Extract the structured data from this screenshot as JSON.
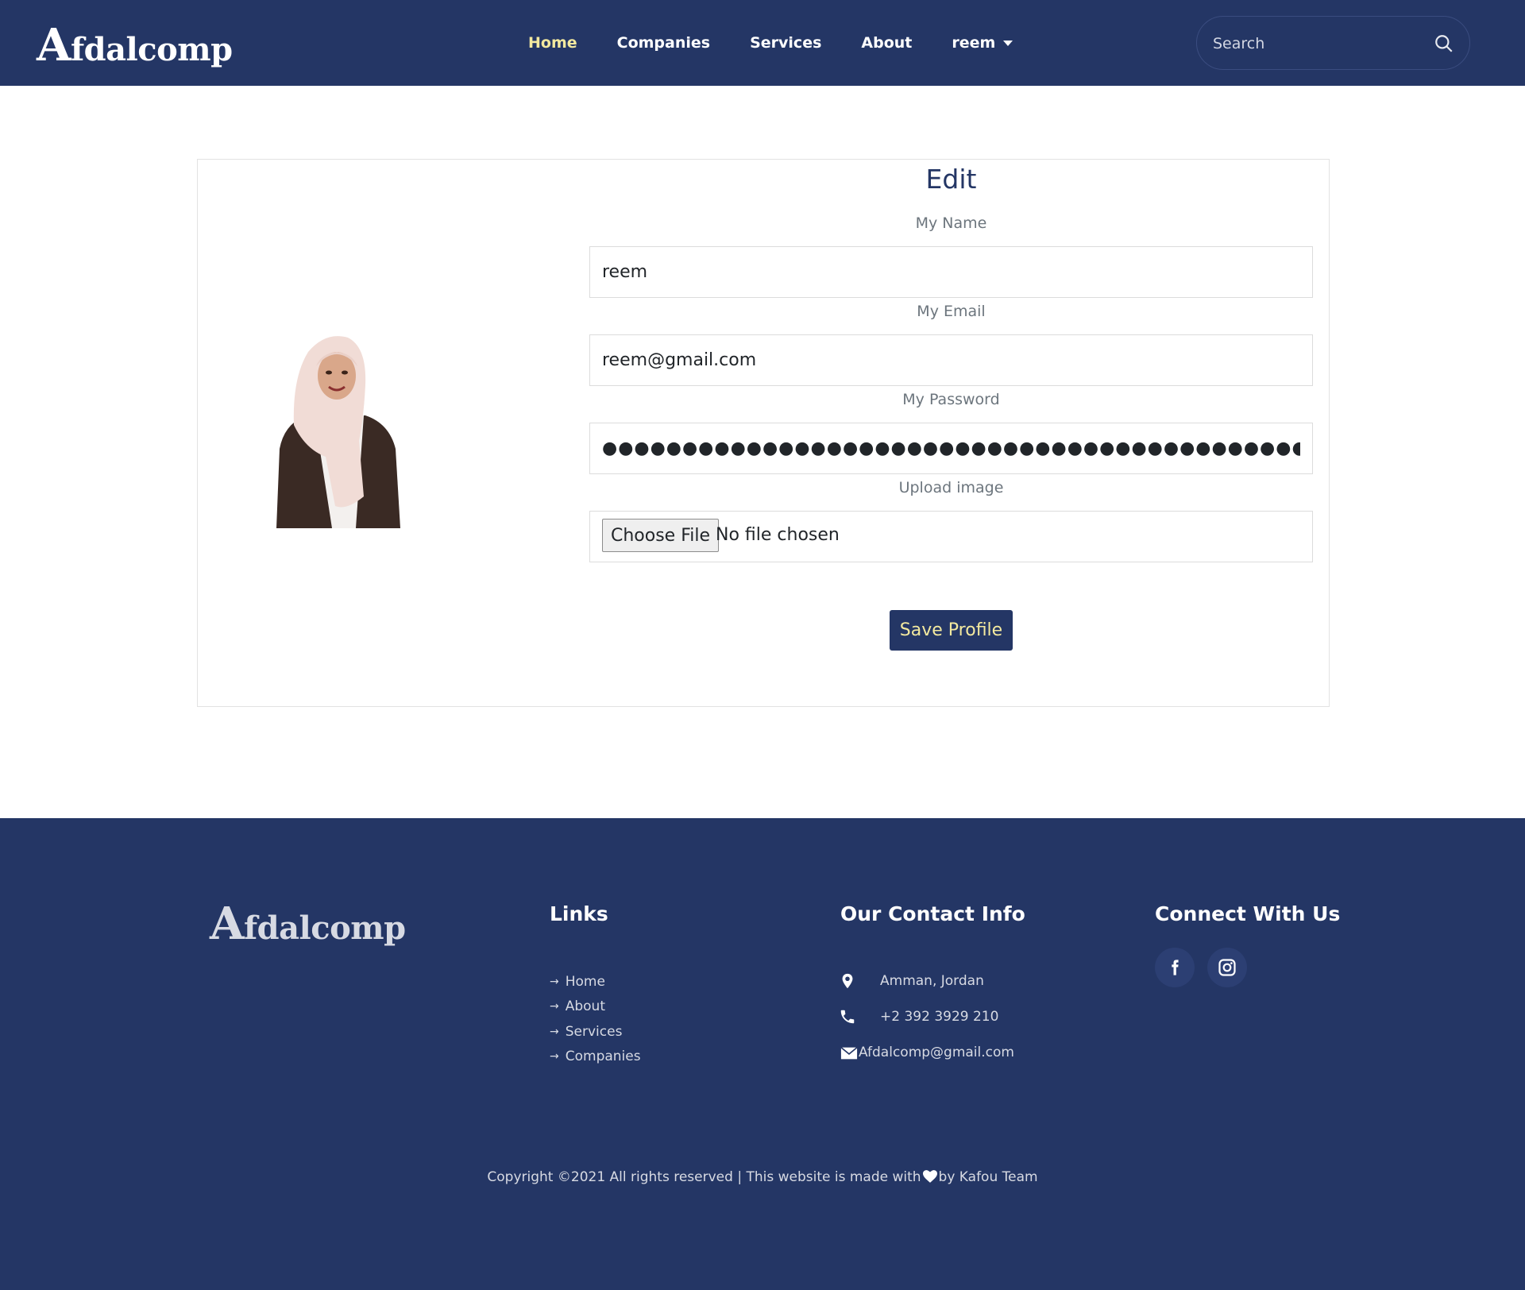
{
  "colors": {
    "primary": "#243665",
    "accent": "#f3e99f",
    "footer_text": "#d7dae3",
    "label": "#6c757d"
  },
  "brand": {
    "logo_first": "A",
    "logo_rest": "fdalcomp"
  },
  "nav": {
    "home": "Home",
    "companies": "Companies",
    "services": "Services",
    "about": "About",
    "user": "reem",
    "search_placeholder": "Search"
  },
  "form": {
    "title": "Edit",
    "name_label": "My Name",
    "name_value": "reem",
    "email_label": "My Email",
    "email_value": "reem@gmail.com",
    "password_label": "My Password",
    "password_value": "●●●●●●●●●●●●●●●●●●●●●●●●●●●●●●●●●●●●●●●●●●●●●●●●●●●●●●●●●●●●",
    "upload_label": "Upload image",
    "choose_file": "Choose File",
    "file_status": "No file chosen",
    "save_button": "Save Profile"
  },
  "footer": {
    "links_heading": "Links",
    "links": [
      "Home",
      "About",
      "Services",
      "Companies"
    ],
    "contact_heading": "Our Contact Info",
    "address": "Amman, Jordan",
    "phone": "+2 392 3929 210",
    "email": "Afdalcomp@gmail.com",
    "connect_heading": "Connect With Us",
    "social": [
      "facebook-icon",
      "instagram-icon"
    ],
    "copyright_before": "Copyright ©2021 All rights reserved | This website is made with",
    "copyright_after": "by Kafou Team"
  }
}
